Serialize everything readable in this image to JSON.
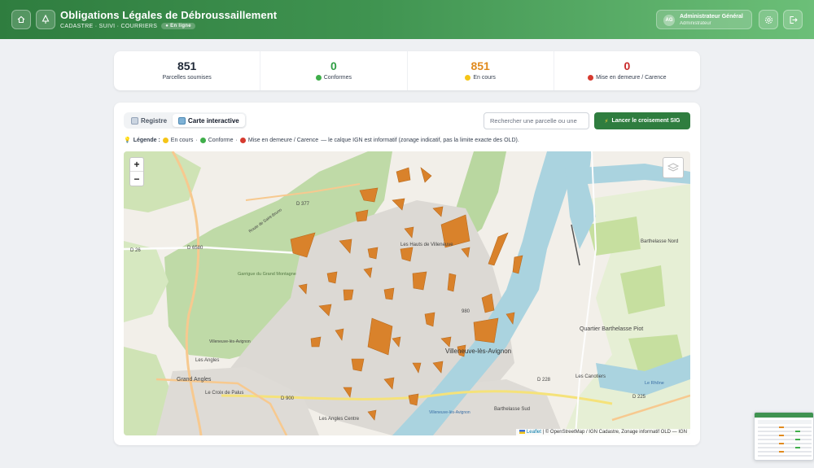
{
  "header": {
    "title": "Obligations Légales de Débroussaillement",
    "subtitle": "CADASTRE · SUIVI · COURRIERS",
    "status_badge": "En ligne",
    "user_initials": "AG",
    "user_name": "Administrateur Général",
    "user_role": "Administrateur"
  },
  "stats": [
    {
      "value": "851",
      "label": "Parcelles soumises",
      "color": "#1f2937"
    },
    {
      "value": "0",
      "label": "Conformes",
      "color": "#2f9e44",
      "dot": "#3fae4a"
    },
    {
      "value": "851",
      "label": "En cours",
      "color": "#e08a1e",
      "dot": "#f5c518"
    },
    {
      "value": "0",
      "label": "Mise en demeure / Carence",
      "color": "#c92a2a",
      "dot": "#d63a2f"
    }
  ],
  "tabs": {
    "registre": "Registre",
    "carte": "Carte interactive"
  },
  "search": {
    "placeholder": "Rechercher une parcelle ou une"
  },
  "launch_button": "Lancer le croisement SIG",
  "legend": {
    "prefix": "Légende :",
    "en_cours": "En cours",
    "conforme": "Conforme",
    "mise_en_demeure": "Mise en demeure / Carence",
    "note": "— le calque IGN est informatif (zonage indicatif, pas la limite exacte des OLD)."
  },
  "map": {
    "zoom_in": "+",
    "zoom_out": "−",
    "attribution_leaflet": "Leaflet",
    "attribution_rest": "| © OpenStreetMap / IGN Cadastre, Zonage informatif OLD — IGN",
    "labels": {
      "d377": "D 377",
      "d26": "D 26",
      "d6580": "D 6580",
      "route_st_bruno": "Route de Saint-Bruno",
      "garrigue": "Garrigue du Grand Montagne",
      "hauts_villeneuve": "Les Hauts de Villeneuve",
      "villeneuve_angles": "Villeneuve-lès-Avignon",
      "les_angles": "Les Angles",
      "grand_angles": "Grand Angles",
      "croix_palus": "Le Croix de Palus",
      "d900": "D 900",
      "les_angles_centre": "Les Angles Centre",
      "villeneuve_main": "Villeneuve-lès-Avignon",
      "villeneuve_small": "Villeneuve-lès-Avignon",
      "quartier": "Quartier Barthelasse Piot",
      "barthelasse_nord": "Barthelasse Nord",
      "barthelasse_sud": "Barthelasse Sud",
      "canotiers": "Les Canotiers",
      "d228": "D 228",
      "d225": "D 225",
      "d980": "980",
      "rhone": "Le Rhône"
    }
  }
}
